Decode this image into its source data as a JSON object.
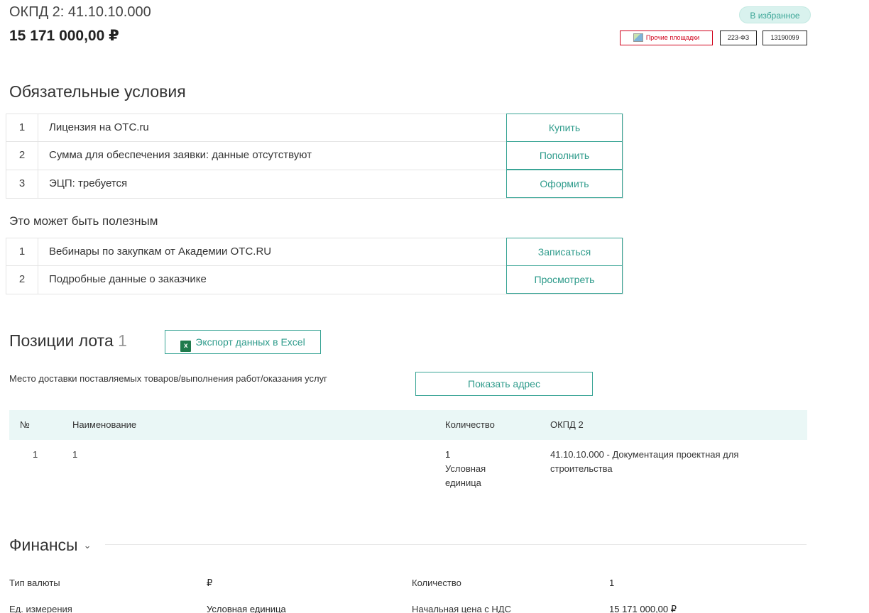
{
  "header": {
    "okpd": "ОКПД 2: 41.10.10.000",
    "price": "15 171 000,00 ₽",
    "favorite_label": "В избранное",
    "tags": [
      "Прочие площадки",
      "223-ФЗ",
      "13190099"
    ]
  },
  "mandatory": {
    "title": "Обязательные условия",
    "rows": [
      {
        "num": "1",
        "text": "Лицензия на OTC.ru",
        "action": "Купить"
      },
      {
        "num": "2",
        "text": "Сумма для обеспечения заявки:  данные отсутствуют",
        "action": "Пополнить"
      },
      {
        "num": "3",
        "text": "ЭЦП: требуется",
        "action": "Оформить"
      }
    ]
  },
  "useful": {
    "title": "Это может быть полезным",
    "rows": [
      {
        "num": "1",
        "text": "Вебинары по закупкам от Академии OTC.RU",
        "action": "Записаться"
      },
      {
        "num": "2",
        "text": "Подробные данные о заказчике",
        "action": "Просмотреть"
      }
    ]
  },
  "lot": {
    "title": "Позиции лота",
    "count": "1",
    "export_label": "Экспорт данных в Excel",
    "delivery_label": "Место доставки поставляемых товаров/выполнения работ/оказания услуг",
    "show_address_label": "Показать адрес",
    "columns": [
      "№",
      "Наименование",
      "Количество",
      "ОКПД 2"
    ],
    "rows": [
      {
        "num": "1",
        "name": "1",
        "qty": "1",
        "unit_line1": "Условная",
        "unit_line2": "единица",
        "okpd_line1": "41.10.10.000 - Документация проектная для",
        "okpd_line2": "строительства"
      }
    ]
  },
  "finance": {
    "title": "Финансы",
    "rows": [
      {
        "label": "Тип валюты",
        "value": "₽",
        "label2": "Количество",
        "value2": "1"
      },
      {
        "label": "Ед. измерения",
        "value": "Условная единица",
        "label2": "Начальная цена с НДС",
        "value2": "15 171 000,00 ₽"
      }
    ]
  },
  "colors": {
    "accent": "#3aa596",
    "table_header_bg": "#eaf7f6",
    "tag_red": "#d0021b"
  }
}
